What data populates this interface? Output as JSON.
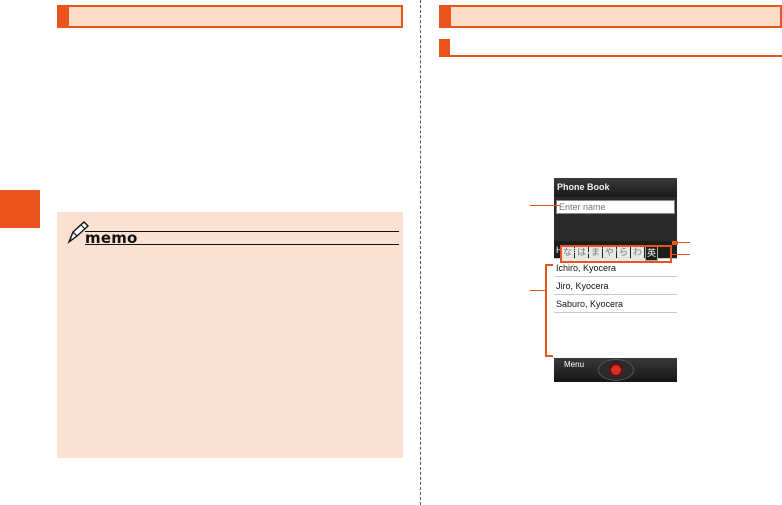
{
  "page": {
    "left_header": "",
    "right_header": "",
    "right_subheader": ""
  },
  "memo": {
    "title": "memo",
    "icon": "pencil-icon"
  },
  "phone": {
    "title": "Phone Book",
    "search_placeholder": "Enter name",
    "kana_tabs": [
      "な",
      "は",
      "ま",
      "や",
      "ら",
      "わ",
      "英"
    ],
    "selected_tab": "英",
    "contacts": [
      "Hanako, Kyocera",
      "Ichiro, Kyocera",
      "Jiro, Kyocera",
      "Saburo, Kyocera"
    ],
    "selected_contact": "Hanako, Kyocera",
    "menu_label": "Menu",
    "center_key": "center-key-icon"
  },
  "colors": {
    "accent": "#e8541c",
    "memo_bg": "#fbe1d2",
    "header_bg": "#fbdcc8"
  }
}
